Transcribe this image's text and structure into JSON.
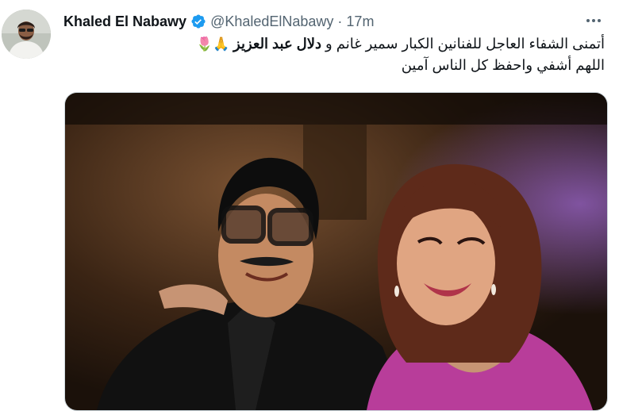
{
  "tweet": {
    "author_name": "Khaled El Nabawy",
    "handle": "@KhaledElNabawy",
    "separator": "·",
    "time": "17m",
    "text_line1_start": "أتمنى الشفاء العاجل للفنانين الكبار سمير غانم و ",
    "text_line1_bold": "دلال عبد العزيز",
    "text_line1_emoji": " 🙏🌷",
    "text_line2": "اللهم أشفي واحفظ كل الناس آمين"
  },
  "icons": {
    "verified": "verified-badge-icon",
    "more": "more-options-icon"
  },
  "colors": {
    "accent": "#1d9bf0",
    "secondary_text": "#536471",
    "primary_text": "#0f1419"
  }
}
